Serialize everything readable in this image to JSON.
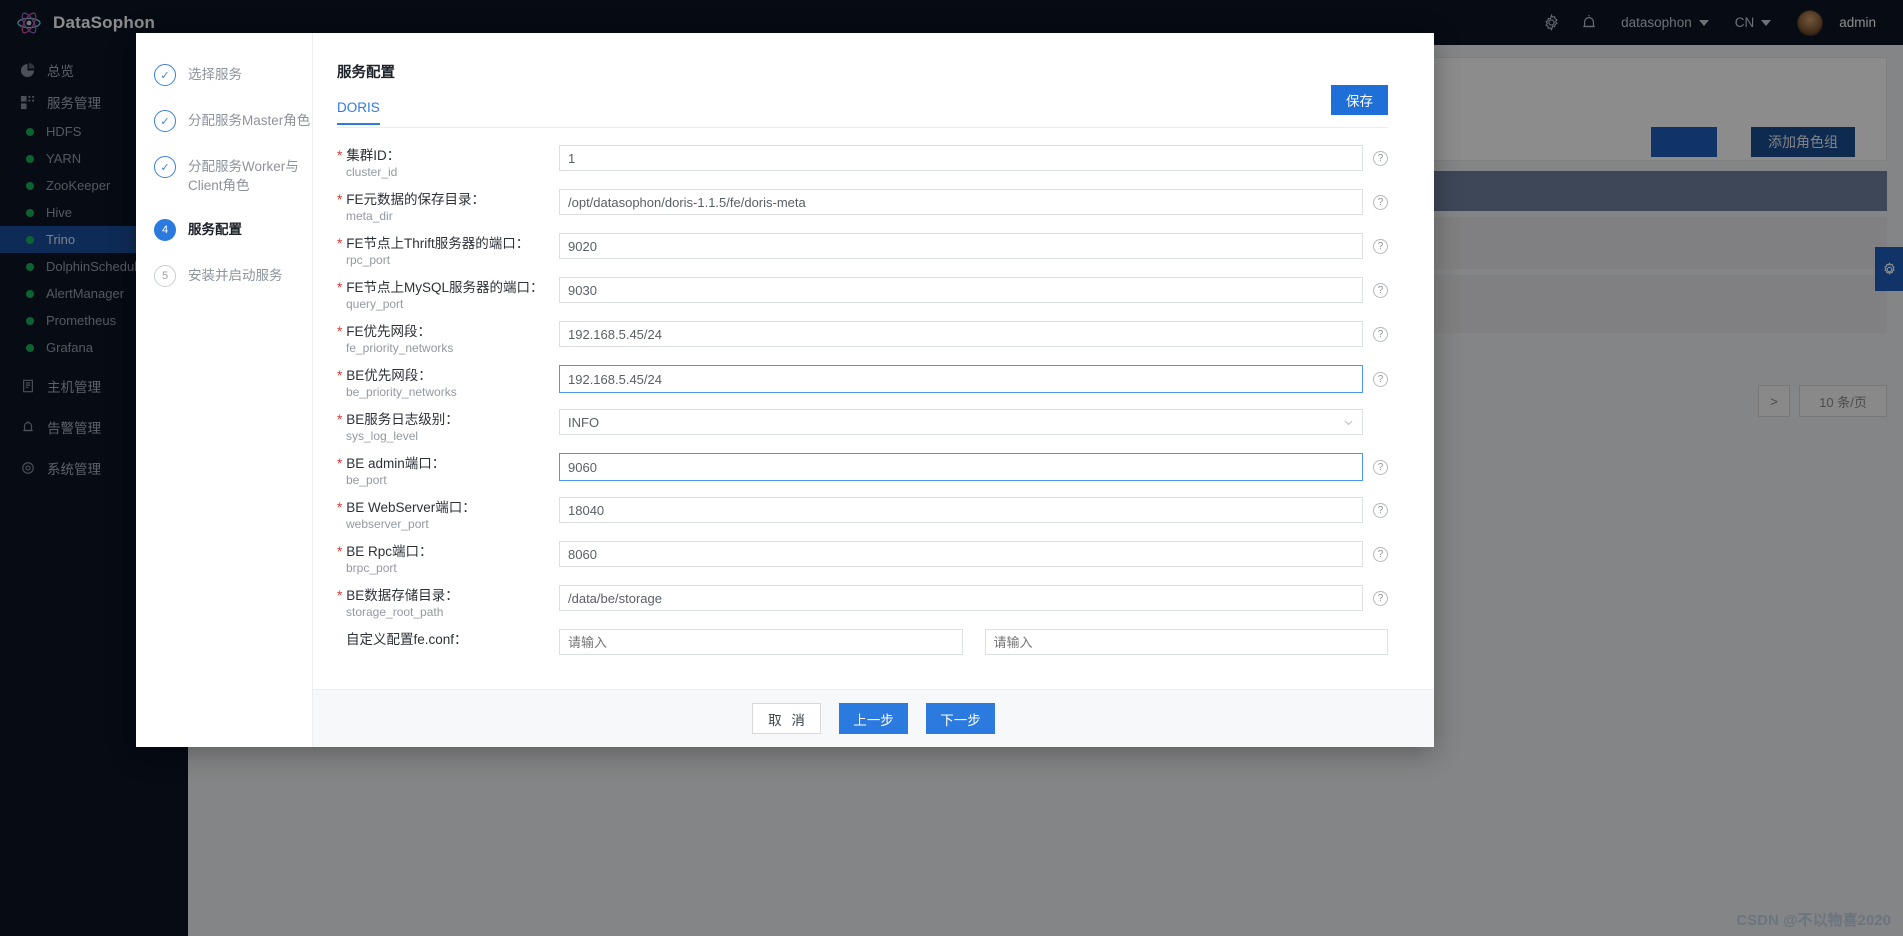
{
  "topbar": {
    "brand": "DataSophon",
    "gear_icon": "gear-icon",
    "alarm_icon": "alarm-bell-icon",
    "cluster": "datasophon",
    "lang": "CN",
    "user": "admin"
  },
  "sidebar": {
    "items": [
      {
        "label": "总览",
        "icon": "overview-icon",
        "type": "group"
      },
      {
        "label": "服务管理",
        "icon": "service-grid-icon",
        "type": "group"
      },
      {
        "label": "HDFS",
        "type": "service",
        "status": "#19b35a"
      },
      {
        "label": "YARN",
        "type": "service",
        "status": "#19b35a"
      },
      {
        "label": "ZooKeeper",
        "type": "service",
        "status": "#19b35a"
      },
      {
        "label": "Hive",
        "type": "service",
        "status": "#19b35a"
      },
      {
        "label": "Trino",
        "type": "service",
        "status": "#19b35a",
        "active": true
      },
      {
        "label": "DolphinScheduler",
        "type": "service",
        "status": "#19b35a"
      },
      {
        "label": "AlertManager",
        "type": "service",
        "status": "#19b35a"
      },
      {
        "label": "Prometheus",
        "type": "service",
        "status": "#19b35a"
      },
      {
        "label": "Grafana",
        "type": "service",
        "status": "#19b35a"
      },
      {
        "label": "主机管理",
        "icon": "host-icon",
        "type": "group"
      },
      {
        "label": "告警管理",
        "icon": "alarm-icon",
        "type": "group"
      },
      {
        "label": "系统管理",
        "icon": "settings-icon",
        "type": "group"
      }
    ]
  },
  "background": {
    "add_role_group_label": "添加角色组",
    "page_size_label": "10 条/页",
    "next_page_label": ">"
  },
  "modal": {
    "steps": [
      {
        "num": "1",
        "label": "选择服务",
        "state": "done"
      },
      {
        "num": "2",
        "label": "分配服务Master角色",
        "state": "done"
      },
      {
        "num": "3",
        "label": "分配服务Worker与Client角色",
        "state": "done"
      },
      {
        "num": "4",
        "label": "服务配置",
        "state": "current"
      },
      {
        "num": "5",
        "label": "安装并启动服务",
        "state": "todo"
      }
    ],
    "title": "服务配置",
    "tab": "DORIS",
    "save_label": "保存",
    "fields": [
      {
        "required": true,
        "label": "集群ID：",
        "key": "cluster_id",
        "value": "1",
        "type": "input",
        "focused": false
      },
      {
        "required": true,
        "label": "FE元数据的保存目录：",
        "key": "meta_dir",
        "value": "/opt/datasophon/doris-1.1.5/fe/doris-meta",
        "type": "input",
        "focused": false
      },
      {
        "required": true,
        "label": "FE节点上Thrift服务器的端口：",
        "key": "rpc_port",
        "value": "9020",
        "type": "input",
        "focused": false
      },
      {
        "required": true,
        "label": "FE节点上MySQL服务器的端口：",
        "key": "query_port",
        "value": "9030",
        "type": "input",
        "focused": false
      },
      {
        "required": true,
        "label": "FE优先网段：",
        "key": "fe_priority_networks",
        "value": "192.168.5.45/24",
        "type": "input",
        "focused": false
      },
      {
        "required": true,
        "label": "BE优先网段：",
        "key": "be_priority_networks",
        "value": "192.168.5.45/24",
        "type": "input",
        "focused": true
      },
      {
        "required": true,
        "label": "BE服务日志级别：",
        "key": "sys_log_level",
        "value": "INFO",
        "type": "select",
        "focused": false
      },
      {
        "required": true,
        "label": "BE admin端口：",
        "key": "be_port",
        "value": "9060",
        "type": "input",
        "focused": true
      },
      {
        "required": true,
        "label": "BE WebServer端口：",
        "key": "webserver_port",
        "value": "18040",
        "type": "input",
        "focused": false
      },
      {
        "required": true,
        "label": "BE Rpc端口：",
        "key": "brpc_port",
        "value": "8060",
        "type": "input",
        "focused": false
      },
      {
        "required": true,
        "label": "BE数据存储目录：",
        "key": "storage_root_path",
        "value": "/data/be/storage",
        "type": "input",
        "focused": false
      },
      {
        "required": false,
        "label": "自定义配置fe.conf：",
        "key": "",
        "value": "",
        "placeholder": "请输入",
        "placeholder2": "请输入",
        "type": "dual",
        "focused": false
      }
    ],
    "footer": {
      "cancel": "取 消",
      "prev": "上一步",
      "next": "下一步"
    }
  },
  "watermark": "CSDN @不以物喜2020"
}
